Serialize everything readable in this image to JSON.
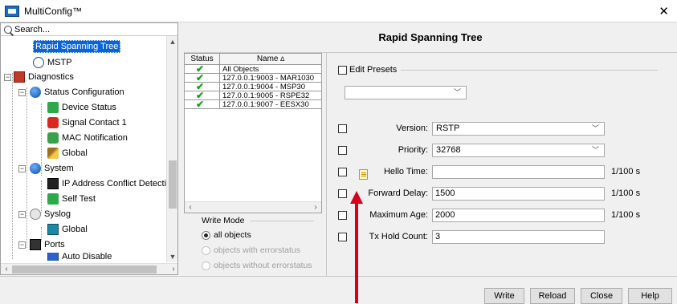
{
  "window": {
    "title": "MultiConfig™",
    "close_glyph": "✕"
  },
  "tree": {
    "search_placeholder": "Search...",
    "items": [
      {
        "label": "Rapid Spanning Tree",
        "icon": "globe-icon"
      },
      {
        "label": "MSTP",
        "icon": "globe-icon"
      },
      {
        "label": "Diagnostics",
        "icon": "diagnostics-icon"
      },
      {
        "label": "Status Configuration",
        "icon": "blue-ball-icon"
      },
      {
        "label": "Device Status",
        "icon": "check-status-icon"
      },
      {
        "label": "Signal Contact 1",
        "icon": "signal-contact-icon"
      },
      {
        "label": "MAC Notification",
        "icon": "mac-icon"
      },
      {
        "label": "Global",
        "icon": "brush-icon"
      },
      {
        "label": "System",
        "icon": "blue-ball-icon"
      },
      {
        "label": "IP Address Conflict Detection In",
        "icon": "monitor-icon"
      },
      {
        "label": "Self Test",
        "icon": "check-status-icon"
      },
      {
        "label": "Syslog",
        "icon": "syslog-icon"
      },
      {
        "label": "Global",
        "icon": "teal-icon"
      },
      {
        "label": "Ports",
        "icon": "ports-icon"
      },
      {
        "label": "Auto Disable",
        "icon": "auto-disable-icon"
      }
    ]
  },
  "panel_title": "Rapid Spanning Tree",
  "status_table": {
    "headers": [
      "Status",
      "Name"
    ],
    "sort_glyph": "∆",
    "rows": [
      {
        "status": "✔",
        "name": "All Objects"
      },
      {
        "status": "✔",
        "name": "127.0.0.1:9003 - MAR1030"
      },
      {
        "status": "✔",
        "name": "127.0.0.1:9004 - MSP30"
      },
      {
        "status": "✔",
        "name": "127.0.0.1:9005 - RSPE32"
      },
      {
        "status": "✔",
        "name": "127.0.0.1:9007 - EESX30"
      }
    ]
  },
  "write_mode": {
    "title": "Write Mode",
    "options": [
      {
        "label": "all objects",
        "selected": true,
        "enabled": true
      },
      {
        "label": "objects with errorstatus",
        "selected": false,
        "enabled": false
      },
      {
        "label": "objects without errorstatus",
        "selected": false,
        "enabled": false
      }
    ]
  },
  "form": {
    "edit_presets": "Edit Presets",
    "preset_value": "",
    "version": {
      "label": "Version:",
      "value": "RSTP"
    },
    "priority": {
      "label": "Priority:",
      "value": "32768"
    },
    "hello_time": {
      "label": "Hello Time:",
      "value": "",
      "unit": "1/100 s"
    },
    "forward_delay": {
      "label": "Forward Delay:",
      "value": "1500",
      "unit": "1/100 s"
    },
    "max_age": {
      "label": "Maximum Age:",
      "value": "2000",
      "unit": "1/100 s"
    },
    "tx_hold": {
      "label": "Tx Hold Count:",
      "value": "3"
    }
  },
  "buttons": {
    "write": "Write",
    "reload": "Reload",
    "close": "Close",
    "help": "Help"
  },
  "colors": {
    "selection": "#0a64d8",
    "check": "#14a01a",
    "arrow": "#d6001c"
  }
}
